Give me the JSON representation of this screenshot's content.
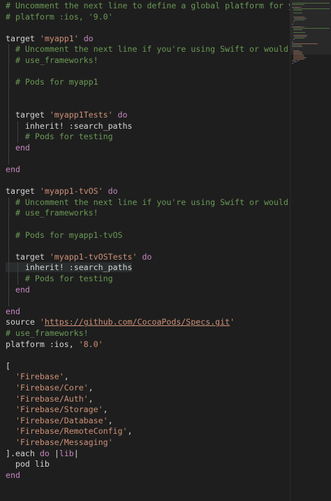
{
  "editor": {
    "lines": [
      [
        {
          "t": "# Uncomment the next line to define a global platform for your project",
          "c": "c"
        }
      ],
      [
        {
          "t": "# platform :ios, '9.0'",
          "c": "c"
        }
      ],
      [],
      [
        {
          "t": "target ",
          "c": "p"
        },
        {
          "t": "'myapp1'",
          "c": "s"
        },
        {
          "t": " do",
          "c": "k"
        }
      ],
      [
        {
          "t": "  # Uncomment the next line if you're using Swift or would like to use dynamic frameworks",
          "c": "c"
        }
      ],
      [
        {
          "t": "  # use_frameworks!",
          "c": "c"
        }
      ],
      [],
      [
        {
          "t": "  # Pods for myapp1",
          "c": "c"
        }
      ],
      [],
      [],
      [
        {
          "t": "  target ",
          "c": "p"
        },
        {
          "t": "'myapp1Tests'",
          "c": "s"
        },
        {
          "t": " do",
          "c": "k"
        }
      ],
      [
        {
          "t": "    inherit! :search_paths",
          "c": "p"
        }
      ],
      [
        {
          "t": "    # Pods for testing",
          "c": "c"
        }
      ],
      [
        {
          "t": "  end",
          "c": "k"
        }
      ],
      [],
      [
        {
          "t": "end",
          "c": "k"
        }
      ],
      [],
      [
        {
          "t": "target ",
          "c": "p"
        },
        {
          "t": "'myapp1-tvOS'",
          "c": "s"
        },
        {
          "t": " do",
          "c": "k"
        }
      ],
      [
        {
          "t": "  # Uncomment the next line if you're using Swift or would like to use dynamic frameworks",
          "c": "c"
        }
      ],
      [
        {
          "t": "  # use_frameworks!",
          "c": "c"
        }
      ],
      [],
      [
        {
          "t": "  # Pods for myapp1-tvOS",
          "c": "c"
        }
      ],
      [],
      [
        {
          "t": "  target ",
          "c": "p"
        },
        {
          "t": "'myapp1-tvOSTests'",
          "c": "s"
        },
        {
          "t": " do",
          "c": "k"
        }
      ],
      [
        {
          "t": "    inherit! :search_paths",
          "c": "p",
          "hl": true
        }
      ],
      [
        {
          "t": "    # Pods for testing",
          "c": "c"
        }
      ],
      [
        {
          "t": "  end",
          "c": "k"
        }
      ],
      [],
      [
        {
          "t": "end",
          "c": "k"
        }
      ],
      [
        {
          "t": "source ",
          "c": "p"
        },
        {
          "t": "'",
          "c": "s"
        },
        {
          "t": "https://github.com/CocoaPods/Specs.git",
          "c": "s",
          "u": true
        },
        {
          "t": "'",
          "c": "s"
        }
      ],
      [
        {
          "t": "# use_frameworks!",
          "c": "c"
        }
      ],
      [
        {
          "t": "platform :ios, ",
          "c": "p"
        },
        {
          "t": "'8.0'",
          "c": "s"
        }
      ],
      [],
      [
        {
          "t": "[",
          "c": "p"
        }
      ],
      [
        {
          "t": "  'Firebase'",
          "c": "s"
        },
        {
          "t": ",",
          "c": "p"
        }
      ],
      [
        {
          "t": "  'Firebase/Core'",
          "c": "s"
        },
        {
          "t": ",",
          "c": "p"
        }
      ],
      [
        {
          "t": "  'Firebase/Auth'",
          "c": "s"
        },
        {
          "t": ",",
          "c": "p"
        }
      ],
      [
        {
          "t": "  'Firebase/Storage'",
          "c": "s"
        },
        {
          "t": ",",
          "c": "p"
        }
      ],
      [
        {
          "t": "  'Firebase/Database'",
          "c": "s"
        },
        {
          "t": ",",
          "c": "p"
        }
      ],
      [
        {
          "t": "  'Firebase/RemoteConfig'",
          "c": "s"
        },
        {
          "t": ",",
          "c": "p"
        }
      ],
      [
        {
          "t": "  'Firebase/Messaging'",
          "c": "s"
        }
      ],
      [
        {
          "t": "].each ",
          "c": "p"
        },
        {
          "t": "do",
          "c": "k"
        },
        {
          "t": " |",
          "c": "p"
        },
        {
          "t": "lib",
          "c": "k"
        },
        {
          "t": "|",
          "c": "p"
        }
      ],
      [
        {
          "t": "  pod lib",
          "c": "p"
        }
      ],
      [
        {
          "t": "end",
          "c": "k"
        }
      ]
    ]
  },
  "colors": {
    "background": "#1e1e1e",
    "comment": "#6a9955",
    "keyword": "#c586c0",
    "string": "#ce9178",
    "plain": "#d4d4d4"
  }
}
